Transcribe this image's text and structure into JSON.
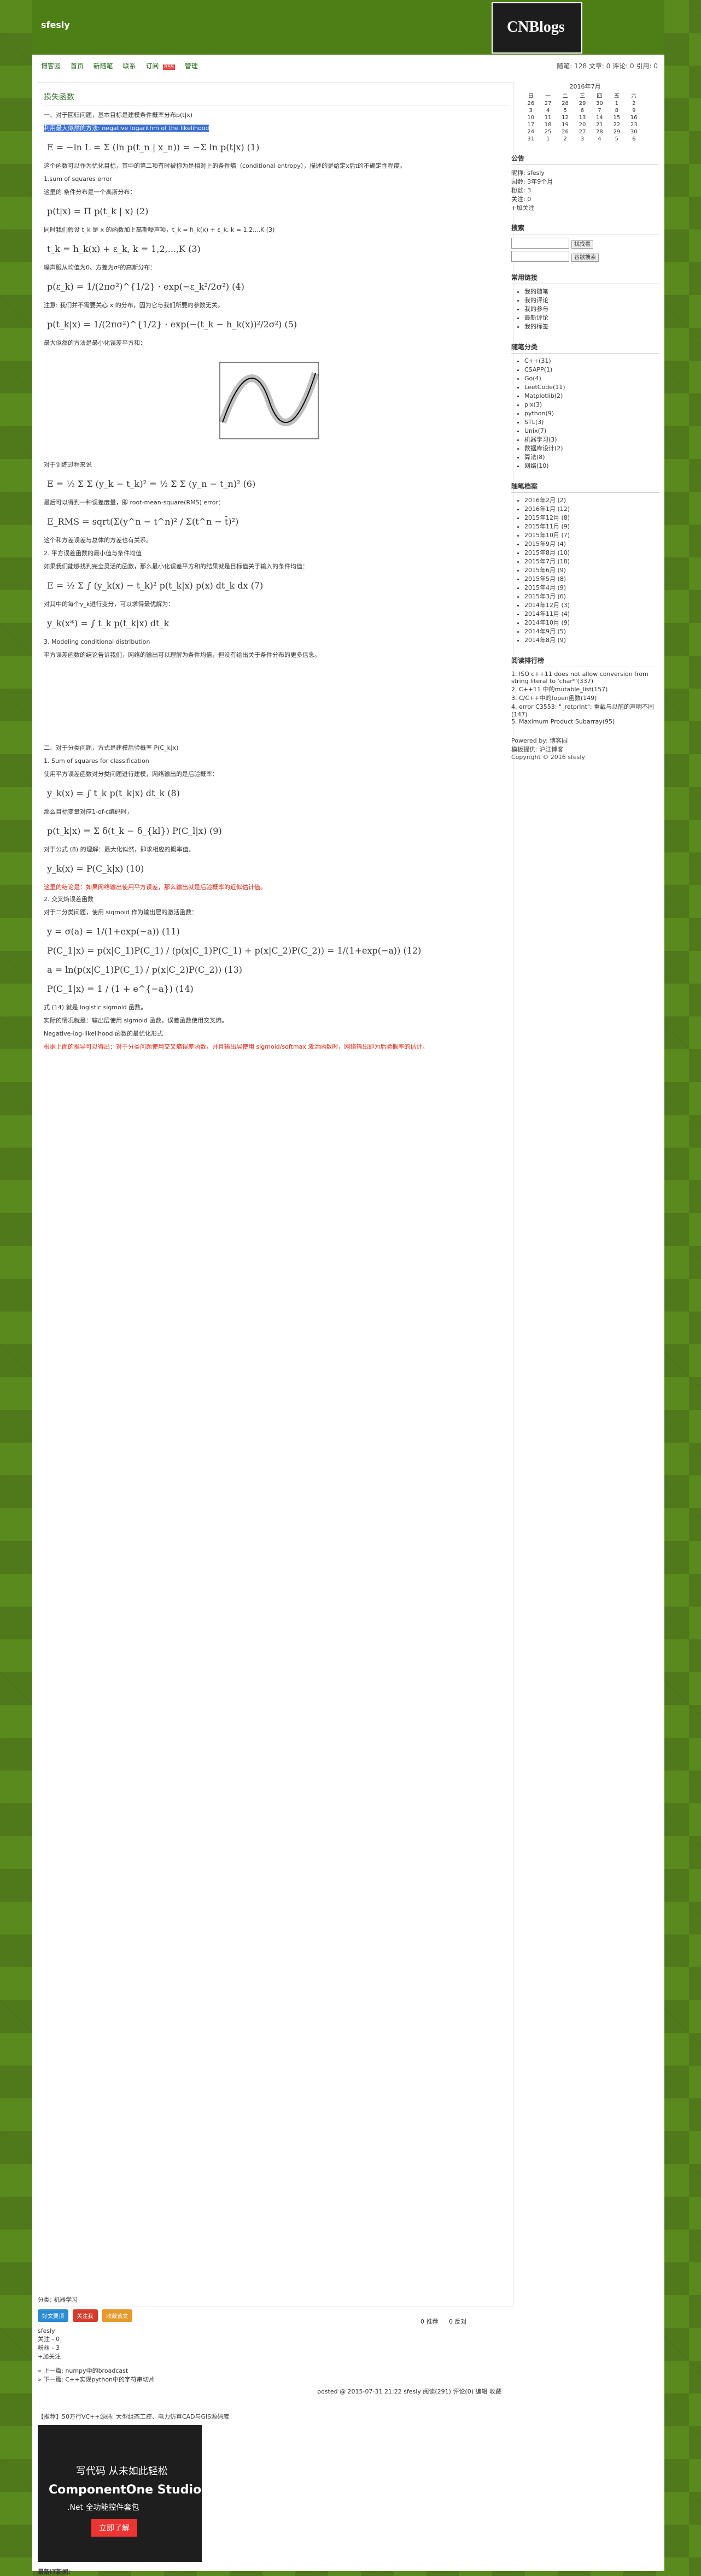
{
  "header": {
    "site_title": "sfesly",
    "logo_text": "CNBlogs",
    "stats": "随笔: 128 文章: 0 评论: 0 引用: 0"
  },
  "nav": [
    "博客园",
    "首页",
    "新随笔",
    "联系",
    "订阅",
    "管理"
  ],
  "post": {
    "title": "损失函数",
    "intro": "一、对于回归问题，基本目标是建模条件概率分布p(t|x)",
    "intro2": "利用最大似然的方法: negative logarithm of the likelihood",
    "formula1": "E = −ln L = Σ (ln p(t_n | x_n)) = −Σ ln p(t|x) (1)",
    "note1": "这个函数可以作为优化目标，其中的第二项有时被称为是相对上的条件熵（conditional entropy），描述的是给定x后t的不确定性程度。",
    "h1": "1.sum of squares error",
    "p1": "这里的 条件分布是一个高斯分布：",
    "formula2": "p(t|x) = Π p(t_k | x) (2)",
    "p2": "同时我们假设 t_k 是 x 的函数加上高斯噪声项，t_k = h_k(x) + ε_k, k = 1,2,...K (3)",
    "formula3": "t_k = h_k(x) + ε_k,  k = 1,2,...,K  (3)",
    "p3": "噪声服从均值为0、方差为σ²的高斯分布：",
    "formula4": "p(ε_k) = 1/(2πσ²)^{1/2} · exp(−ε_k²/2σ²) (4)",
    "p4": "注意: 我们并不需要关心 x 的分布，因为它与我们所要的参数无关。",
    "formula5": "p(t_k|x) = 1/(2πσ²)^{1/2} · exp(−(t_k − h_k(x))²/2σ²) (5)",
    "p5": "最大似然的方法是最小化误差平方和：",
    "p6": "对于训练过程来说",
    "formula6": "E = ½ Σ Σ (y_k − t_k)² = ½ Σ Σ (y_n − t_n)² (6)",
    "p7": "最后可以得到一种误差度量，即 root-mean-square(RMS) error：",
    "formula7": "E_RMS = sqrt(Σ(y^n − t^n)² / Σ(t^n − t̄)²)",
    "p8": "这个和方差误差与总体的方差也有关系。",
    "p9": "2. 平方误差函数的最小值与条件均值",
    "p10": "如果我们能够找到完全灵活的函数，那么最小化误差平方和的结果就是目标值关于输入的条件均值：",
    "formula8": "E = ½ Σ ∫ (y_k(x) − t_k)² p(t_k|x) p(x) dt_k dx (7)",
    "p11": "对其中的每个y_k进行变分，可以求得最优解为：",
    "formula9": "y_k(x*) = ∫ t_k p(t_k|x) dt_k",
    "p12": "3. Modeling conditional distribution",
    "p13": "平方误差函数的结论告诉我们，网络的输出可以理解为条件均值，但没有给出关于条件分布的更多信息。",
    "h2": "二、对于分类问题，方式是建模后验概率 P(C_k|x)",
    "p14": "1. Sum of squares for classification",
    "p15": "使用平方误差函数对分类问题进行建模，网络输出的是后验概率：",
    "formula10": "y_k(x) = ∫ t_k p(t_k|x) dt_k (8)",
    "p16": "那么目标变量对应1-of-c编码时，",
    "formula11": "p(t_k|x) = Σ δ(t_k − δ_{kl}) P(C_l|x)  (9)",
    "p17": "对于公式 (8) 的理解：最大化似然，即求相应的概率值。",
    "formula12": "y_k(x) = P(C_k|x)  (10)",
    "red1": "这里的结论是：如果网络输出使用平方误差，那么输出就是后验概率的近似估计值。",
    "p18": "2. 交叉熵误差函数",
    "p19": "对于二分类问题，使用 sigmoid 作为输出层的激活函数：",
    "formula13": "y = σ(a) = 1/(1+exp(−a))  (11)",
    "formula14": "P(C_1|x) = p(x|C_1)P(C_1) / (p(x|C_1)P(C_1) + p(x|C_2)P(C_2)) = 1/(1+exp(−a))  (12)",
    "formula15": "a = ln(p(x|C_1)P(C_1) / p(x|C_2)P(C_2))  (13)",
    "formula16": "P(C_1|x) = 1 / (1 + e^{−a})  (14)",
    "p20": "式 (14) 就是 logistic sigmoid 函数。",
    "p21": "实际的情况就是：输出层使用 sigmoid 函数，误差函数使用交叉熵。",
    "p22": "Negative-log-likelihood 函数的最优化形式",
    "red2": "根据上面的推导可以得出：对于分类问题使用交叉熵误差函数，并且输出层使用 sigmoid/softmax 激活函数时，网络输出即为后验概率的估计。"
  },
  "post_meta": {
    "category": "分类: 机器学习",
    "buttons": [
      "好文要顶",
      "关注我",
      "收藏该文"
    ],
    "author": "sfesly",
    "follow": "关注 - 0",
    "fans": "粉丝 - 3",
    "add_follow": "+加关注",
    "like_count": "0",
    "dislike_count": "0",
    "like_label": "推荐",
    "dislike_label": "反对",
    "prev": "« 上一篇: numpy中的broadcast",
    "next": "» 下一篇: C++实现python中的字符串切片",
    "posted": "posted @ 2015-07-31 21:22 sfesly 阅读(291) 评论(0) 编辑 收藏",
    "ad_hint": "【推荐】50万行VC++源码: 大型组态工控、电力仿真CAD与GIS源码库",
    "ad_title1": "写代码  从未如此轻松",
    "ad_title2": "ComponentOne Studio",
    "ad_title3": ".Net 全功能控件套包",
    "ad_button": "立即了解",
    "news_title": "最新IT新闻:"
  },
  "sidebar": {
    "calendar_title": "2016年7月",
    "weekdays": [
      "日",
      "一",
      "二",
      "三",
      "四",
      "五",
      "六"
    ],
    "weeks": [
      [
        "26",
        "27",
        "28",
        "29",
        "30",
        "1",
        "2"
      ],
      [
        "3",
        "4",
        "5",
        "6",
        "7",
        "8",
        "9"
      ],
      [
        "10",
        "11",
        "12",
        "13",
        "14",
        "15",
        "16"
      ],
      [
        "17",
        "18",
        "19",
        "20",
        "21",
        "22",
        "23"
      ],
      [
        "24",
        "25",
        "26",
        "27",
        "28",
        "29",
        "30"
      ],
      [
        "31",
        "1",
        "2",
        "3",
        "4",
        "5",
        "6"
      ]
    ],
    "notice_title": "公告",
    "notice": [
      "昵称: sfesly",
      "园龄: 3年9个月",
      "粉丝: 3",
      "关注: 0",
      "+加关注"
    ],
    "search_title": "搜索",
    "search_btn": "找找看",
    "google_btn": "谷歌搜索",
    "common_title": "常用链接",
    "common": [
      "我的随笔",
      "我的评论",
      "我的参与",
      "最新评论",
      "我的标签"
    ],
    "tags_title": "随笔分类",
    "tags": [
      "C++(31)",
      "CSAPP(1)",
      "Go(4)",
      "LeetCode(11)",
      "Matplotlib(2)",
      "pix(3)",
      "python(9)",
      "STL(3)",
      "Unix(7)",
      "机器学习(3)",
      "数据库设计(2)",
      "算法(8)",
      "网络(10)"
    ],
    "archive_title": "随笔档案",
    "archive": [
      "2016年2月 (2)",
      "2016年1月 (12)",
      "2015年12月 (8)",
      "2015年11月 (9)",
      "2015年10月 (7)",
      "2015年9月 (4)",
      "2015年8月 (10)",
      "2015年7月 (18)",
      "2015年6月 (9)",
      "2015年5月 (8)",
      "2015年4月 (9)",
      "2015年3月 (6)",
      "2014年12月 (3)",
      "2014年11月 (4)",
      "2014年10月 (9)",
      "2014年9月 (5)",
      "2014年8月 (9)"
    ],
    "rank_title": "阅读排行榜",
    "rank": [
      "1. ISO c++11 does not allow conversion from string literal to 'char*'(337)",
      "2. C++11 中的mutable_list(157)",
      "3. C/C++中的fopen函数(149)",
      "4. error C3553: \"_retprint\": 重载与以前的声明不同(147)",
      "5. Maximum Product Subarray(95)"
    ],
    "powered": "Powered by: 博客园",
    "theme": "模板提供: 沪江博客",
    "copyright": "Copyright © 2016 sfesly"
  }
}
